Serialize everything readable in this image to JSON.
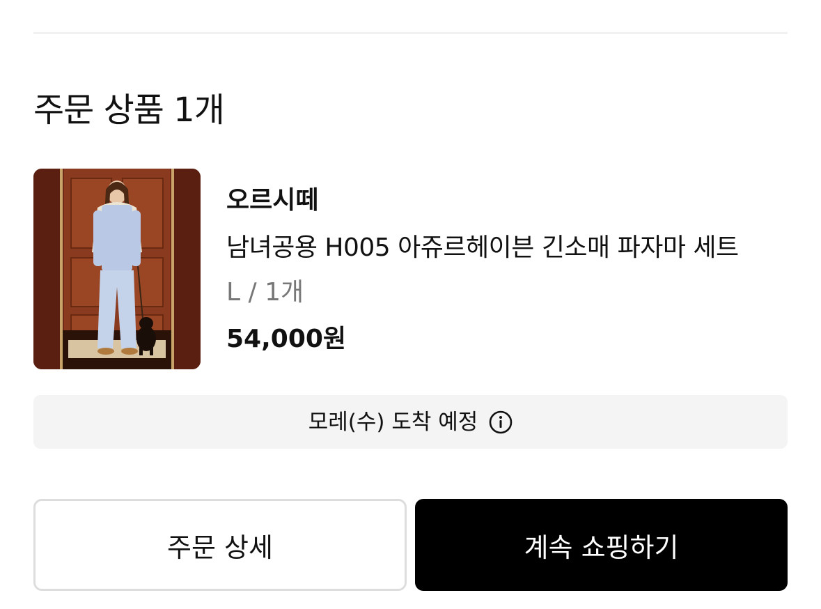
{
  "section": {
    "title": "주문 상품 1개"
  },
  "product": {
    "brand": "오르시떼",
    "name": "남녀공용 H005 아쥬르헤이븐 긴소매 파자마 세트",
    "option": "L / 1개",
    "price": "54,000원"
  },
  "delivery": {
    "text": "모레(수) 도착 예정",
    "icon": "info-icon"
  },
  "buttons": {
    "order_detail": "주문 상세",
    "continue_shopping": "계속 쇼핑하기"
  },
  "colors": {
    "primary_button": "#000000",
    "delivery_bg": "#f4f4f4",
    "option_text": "#777777"
  }
}
